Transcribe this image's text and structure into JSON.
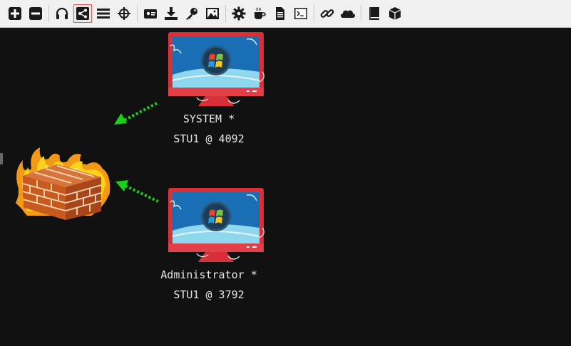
{
  "toolbar": {
    "buttons": [
      {
        "icon": "add-icon"
      },
      {
        "icon": "remove-icon"
      },
      {
        "icon": "headphones-icon"
      },
      {
        "icon": "pivot-graph-icon",
        "active": true
      },
      {
        "icon": "list-icon"
      },
      {
        "icon": "crosshair-icon"
      },
      {
        "icon": "screenshot-icon"
      },
      {
        "icon": "download-icon"
      },
      {
        "icon": "key-icon"
      },
      {
        "icon": "image-icon"
      },
      {
        "icon": "gear-icon"
      },
      {
        "icon": "coffee-icon"
      },
      {
        "icon": "document-icon"
      },
      {
        "icon": "terminal-icon"
      },
      {
        "icon": "link-icon"
      },
      {
        "icon": "cloud-icon"
      },
      {
        "icon": "book-icon"
      },
      {
        "icon": "cube-icon"
      }
    ],
    "active_border_color": "#e35858"
  },
  "graph": {
    "firewall": {
      "icon": "firewall-icon"
    },
    "sessions": [
      {
        "user": "SYSTEM *",
        "host": "STU1 @ 4092"
      },
      {
        "user": "Administrator *",
        "host": "STU1 @ 3792"
      }
    ],
    "link_color": "#18d018"
  }
}
